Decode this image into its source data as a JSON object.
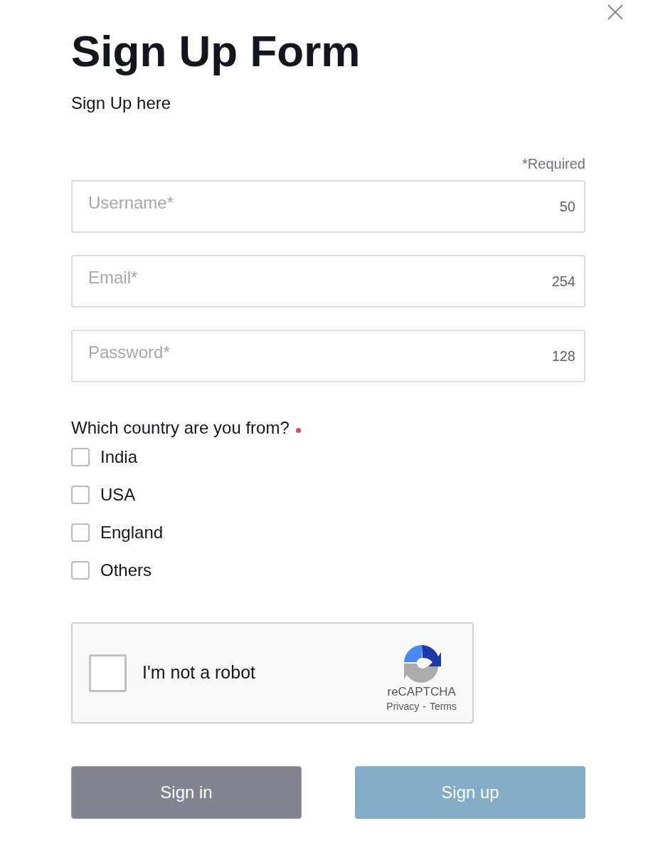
{
  "title": "Sign Up Form",
  "subtitle": "Sign Up here",
  "required_note": "*Required",
  "fields": [
    {
      "placeholder": "Username*",
      "counter": "50"
    },
    {
      "placeholder": "Email*",
      "counter": "254"
    },
    {
      "placeholder": "Password*",
      "counter": "128"
    }
  ],
  "question": {
    "label": "Which country are you from?",
    "required": true
  },
  "options": [
    {
      "label": "India",
      "checked": false
    },
    {
      "label": "USA",
      "checked": false
    },
    {
      "label": "England",
      "checked": false
    },
    {
      "label": "Others",
      "checked": false
    }
  ],
  "captcha": {
    "label": "I'm not a robot",
    "checked": false,
    "brand": "reCAPTCHA",
    "links": [
      "Privacy",
      "Terms"
    ],
    "separator": "-"
  },
  "buttons": [
    {
      "label": "Sign in",
      "kind": "secondary"
    },
    {
      "label": "Sign up",
      "kind": "primary"
    }
  ]
}
